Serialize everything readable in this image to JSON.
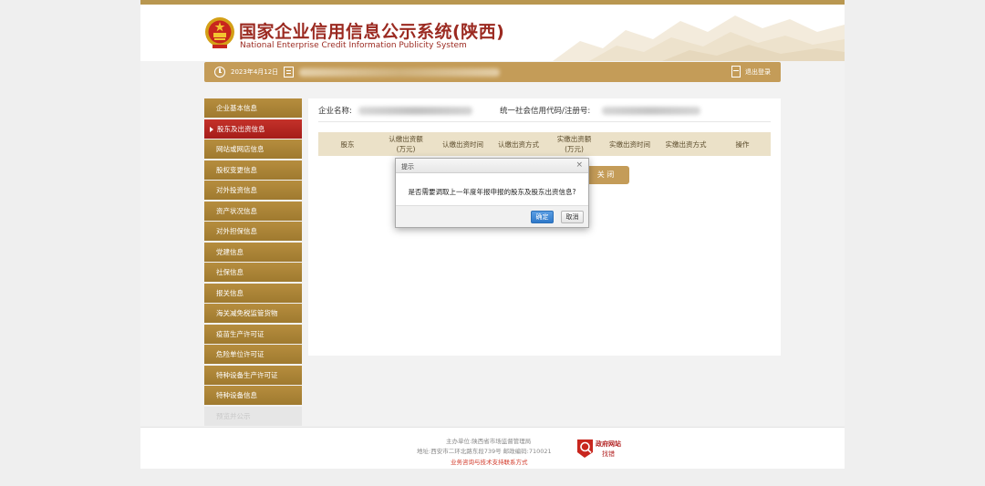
{
  "header": {
    "title": "国家企业信用信息公示系统(陕西)",
    "subtitle": "National Enterprise Credit Information Publicity System"
  },
  "infobar": {
    "date": "2023年4月12日",
    "logout": "退出登录"
  },
  "sidebar": {
    "items": [
      {
        "label": "企业基本信息"
      },
      {
        "label": "股东及出资信息",
        "active": true
      },
      {
        "label": "网站或网店信息"
      },
      {
        "label": "股权变更信息"
      },
      {
        "label": "对外投资信息"
      },
      {
        "label": "资产状况信息"
      },
      {
        "label": "对外担保信息"
      },
      {
        "label": "党建信息"
      },
      {
        "label": "社保信息"
      },
      {
        "label": "报关信息"
      },
      {
        "label": "海关减免税监管货物"
      },
      {
        "label": "疫苗生产许可证"
      },
      {
        "label": "危险单位许可证"
      },
      {
        "label": "特种设备生产许可证"
      },
      {
        "label": "特种设备信息"
      },
      {
        "label": "预览并公示",
        "disabled": true
      }
    ]
  },
  "main": {
    "entity_label": "企业名称:",
    "credit_label": "统一社会信用代码/注册号:",
    "table_headers": [
      "股东",
      "认缴出资额\n(万元)",
      "认缴出资时间",
      "认缴出资方式",
      "实缴出资额\n(万元)",
      "实缴出资时间",
      "实缴出资方式",
      "操作"
    ],
    "close_label": "关 闭"
  },
  "dialog": {
    "title": "提示",
    "close": "×",
    "message": "是否需要调取上一年度年报申报的股东及股东出资信息?",
    "ok": "确定",
    "cancel": "取消"
  },
  "footer": {
    "host": "主办单位:陕西省市场监督管理局",
    "address": "地址:西安市二环北路东段739号   邮政编码:710021",
    "support": "业务咨询与技术支持联系方式",
    "gov_line1": "政府网站",
    "gov_line2": "找错"
  },
  "colors": {
    "brand_gold": "#c49c58",
    "menu_gold": "#b68d3e",
    "active_red": "#a51d19",
    "title_red": "#9b2a21",
    "ok_blue": "#2e78c9"
  }
}
